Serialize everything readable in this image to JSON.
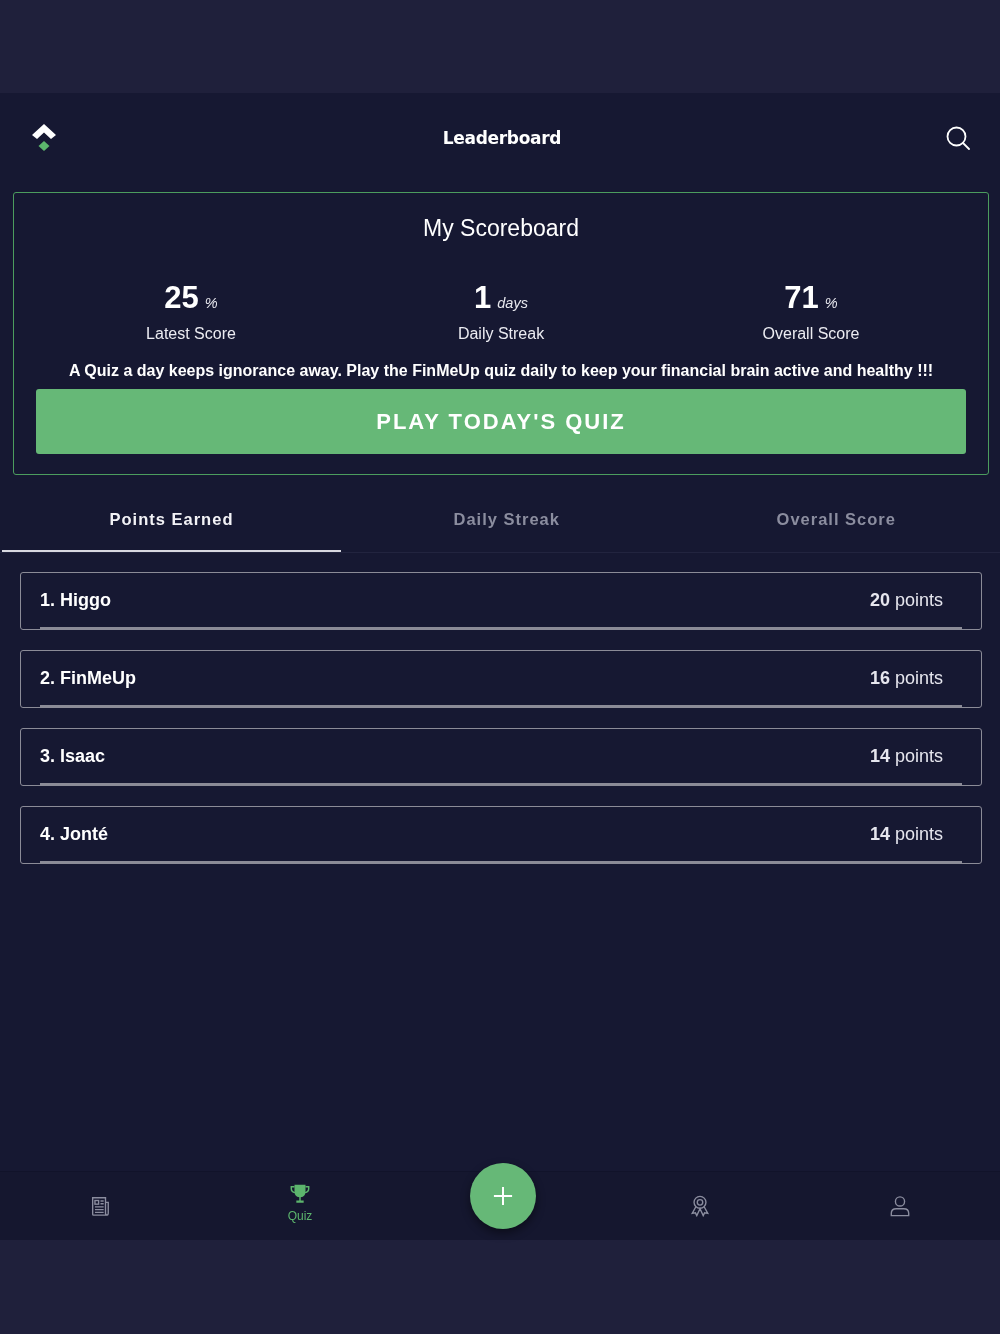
{
  "header": {
    "title": "Leaderboard"
  },
  "scoreboard": {
    "title": "My Scoreboard",
    "stats": [
      {
        "value": "25",
        "unit": "%",
        "label": "Latest Score"
      },
      {
        "value": "1",
        "unit": "days",
        "label": "Daily Streak"
      },
      {
        "value": "71",
        "unit": "%",
        "label": "Overall Score"
      }
    ],
    "message": "A Quiz a day keeps ignorance away. Play the FinMeUp quiz daily to keep your financial brain active and healthy !!!",
    "button": "PLAY TODAY'S QUIZ"
  },
  "tabs": [
    {
      "label": "Points Earned",
      "selected": true
    },
    {
      "label": "Daily Streak",
      "selected": false
    },
    {
      "label": "Overall Score",
      "selected": false
    }
  ],
  "leaderboard": [
    {
      "rank": "1.",
      "name": "Higgo",
      "points": "**20** points"
    },
    {
      "rank": "2.",
      "name": "FinMeUp",
      "points": "**16** points"
    },
    {
      "rank": "3.",
      "name": "Isaac",
      "points": "**14** points"
    },
    {
      "rank": "4.",
      "name": "Jonté",
      "points": "**14** points"
    }
  ],
  "bottom_nav": [
    {
      "kind": "news",
      "selected": false
    },
    {
      "kind": "trophy",
      "label": "Quiz",
      "selected": true
    },
    {
      "kind": "add"
    },
    {
      "kind": "award",
      "selected": false
    },
    {
      "kind": "profile",
      "selected": false
    }
  ]
}
